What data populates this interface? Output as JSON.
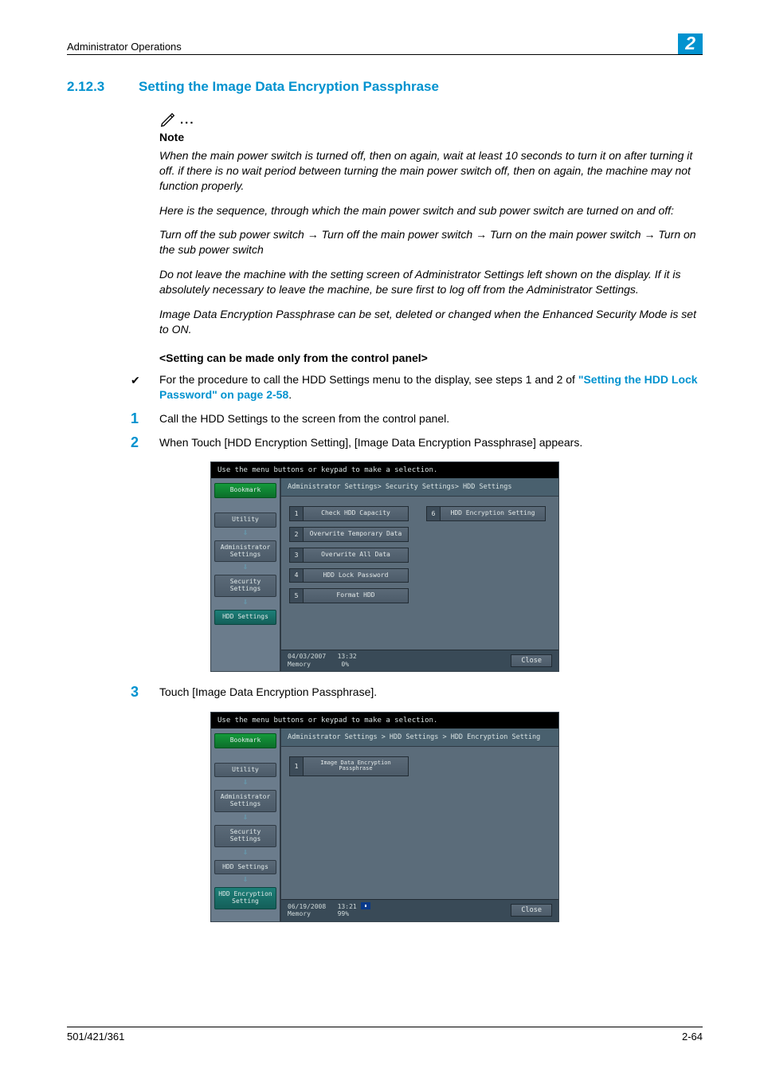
{
  "header": {
    "title": "Administrator Operations",
    "chapter": "2"
  },
  "section": {
    "number": "2.12.3",
    "title": "Setting the Image Data Encryption Passphrase"
  },
  "note": {
    "heading": "Note",
    "p1": "When the main power switch is turned off, then on again, wait at least 10 seconds to turn it on after turning it off. if there is no wait period between turning the main power switch off, then on again, the machine may not function properly.",
    "p2": "Here is the sequence, through which the main power switch and sub power switch are turned on and off:",
    "p3": "Turn off the sub power switch → Turn off the main power switch → Turn on the main power switch → Turn on the sub power switch",
    "p4": "Do not leave the machine with the setting screen of Administrator Settings left shown on the display. If it is absolutely necessary to leave the machine, be sure first to log off from the Administrator Settings.",
    "p5": "Image Data Encryption Passphrase can be set, deleted or changed when the Enhanced Security Mode is set to ON."
  },
  "subheading": "<Setting can be made only from the control panel>",
  "bullet": {
    "lead": "For the procedure to call the HDD Settings menu to the display, see steps 1 and 2 of ",
    "link": "\"Setting the HDD Lock Password\" on page 2-58",
    "trail": "."
  },
  "steps": {
    "s1": "Call the HDD Settings to the screen from the control panel.",
    "s2": "When Touch [HDD Encryption Setting], [Image Data Encryption Passphrase] appears.",
    "s3": "Touch [Image Data Encryption Passphrase]."
  },
  "shot1": {
    "top": "Use the menu buttons or keypad to make a selection.",
    "crumb": "Administrator Settings> Security Settings> HDD Settings",
    "side": {
      "bookmark": "Bookmark",
      "utility": "Utility",
      "admin": "Administrator\nSettings",
      "security": "Security\nSettings",
      "hdd": "HDD Settings"
    },
    "items": {
      "i1": "Check HDD Capacity",
      "i2": "Overwrite Temporary Data",
      "i3": "Overwrite All Data",
      "i4": "HDD Lock Password",
      "i5": "Format HDD",
      "i6": "HDD Encryption Setting"
    },
    "footer_left": "04/03/2007   13:32\nMemory        0%",
    "close": "Close"
  },
  "shot2": {
    "top": "Use the menu buttons or keypad to make a selection.",
    "crumb": "Administrator Settings > HDD Settings > HDD Encryption Setting",
    "side": {
      "bookmark": "Bookmark",
      "utility": "Utility",
      "admin": "Administrator\nSettings",
      "security": "Security\nSettings",
      "hdd": "HDD Settings",
      "enc": "HDD Encryption\nSetting"
    },
    "items": {
      "i1": "Image Data Encryption\nPassphrase"
    },
    "footer_left": "06/19/2008   13:21 ",
    "footer_left2": "Memory       99%",
    "close": "Close"
  },
  "footer": {
    "left": "501/421/361",
    "right": "2-64"
  }
}
